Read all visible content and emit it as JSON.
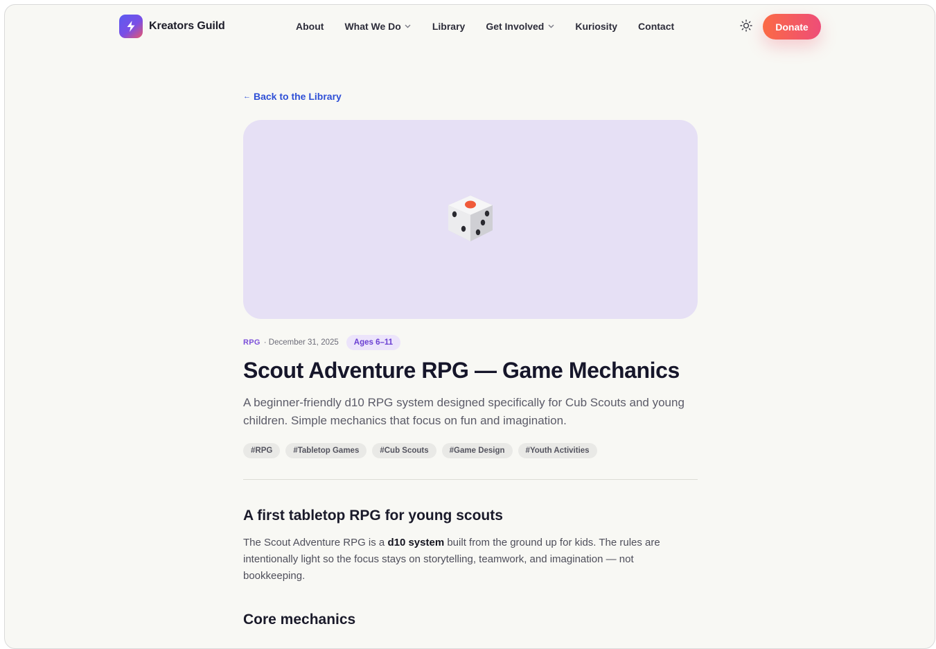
{
  "header": {
    "brand": "Kreators Guild",
    "nav": [
      {
        "label": "About",
        "has_dropdown": false
      },
      {
        "label": "What We Do",
        "has_dropdown": true
      },
      {
        "label": "Library",
        "has_dropdown": false
      },
      {
        "label": "Get Involved",
        "has_dropdown": true
      },
      {
        "label": "Kuriosity",
        "has_dropdown": false
      },
      {
        "label": "Contact",
        "has_dropdown": false
      }
    ],
    "theme_toggle_icon": "sun-icon",
    "donate_label": "Donate"
  },
  "article": {
    "back_arrow": "←",
    "back_label": "Back to the Library",
    "hero_icon": "dice-icon",
    "category": "RPG",
    "date": "· December 31, 2025",
    "age_badge": "Ages 6–11",
    "title": "Scout Adventure RPG — Game Mechanics",
    "subtitle": "A beginner-friendly d10 RPG system designed specifically for Cub Scouts and young children. Simple mechanics that focus on fun and imagination.",
    "tags": [
      "#RPG",
      "#Tabletop Games",
      "#Cub Scouts",
      "#Game Design",
      "#Youth Activities"
    ],
    "section1_heading": "A first tabletop RPG for young scouts",
    "section1_para_before": "The Scout Adventure RPG is a ",
    "section1_para_bold": "d10 system",
    "section1_para_after": " built from the ground up for kids. The rules are intentionally light so the focus stays on storytelling, teamwork, and imagination — not bookkeeping.",
    "section2_heading": "Core mechanics"
  },
  "colors": {
    "page_bg": "#f8f8f4",
    "accent_link": "#2e4fd6",
    "hero_bg": "#e6e0f5",
    "category_purple": "#7b4fd9",
    "donate_gradient_start": "#fb6a45",
    "donate_gradient_end": "#ee4d78"
  }
}
